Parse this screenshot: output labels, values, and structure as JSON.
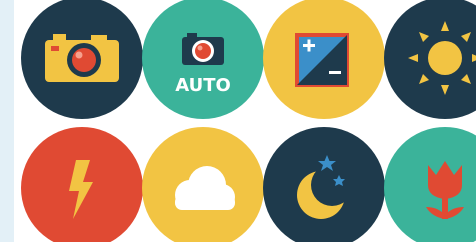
{
  "icons": [
    {
      "name": "camera-icon",
      "bg": "#1e3a4c"
    },
    {
      "name": "auto-camera-icon",
      "bg": "#3bb39a",
      "label": "AUTO"
    },
    {
      "name": "exposure-icon",
      "bg": "#f2c443"
    },
    {
      "name": "sun-icon",
      "bg": "#1e3a4c"
    },
    {
      "name": "flash-icon",
      "bg": "#e04a33"
    },
    {
      "name": "cloud-icon",
      "bg": "#f2c443"
    },
    {
      "name": "night-moon-icon",
      "bg": "#1e3a4c"
    },
    {
      "name": "macro-tulip-icon",
      "bg": "#3bb39a"
    }
  ],
  "colors": {
    "navy": "#1e3a4c",
    "teal": "#3bb39a",
    "yellow": "#f2c443",
    "red": "#e04a33",
    "white": "#ffffff",
    "sky": "#3b8fc9"
  }
}
